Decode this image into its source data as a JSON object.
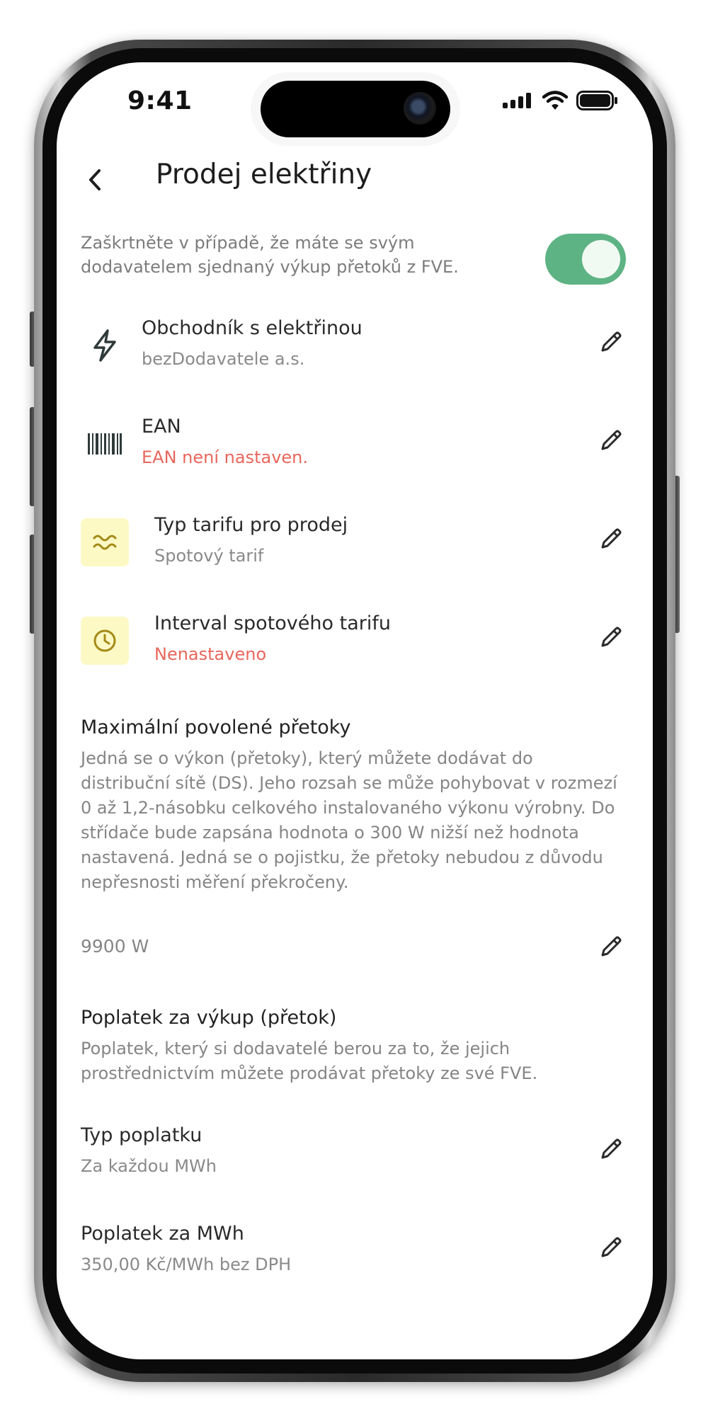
{
  "status_bar": {
    "time": "9:41"
  },
  "header": {
    "title": "Prodej elektřiny"
  },
  "intro": {
    "text": "Zaškrtněte v případě, že máte se svým dodavatelem sjednaný výkup přetoků z FVE.",
    "toggle_on": true,
    "toggle_color": "#5eb384"
  },
  "rows": [
    {
      "icon": "lightning-icon",
      "title": "Obchodník s elektřinou",
      "subtitle": "bezDodavatele a.s.",
      "subtitle_error": false
    },
    {
      "icon": "barcode-icon",
      "title": "EAN",
      "subtitle": "EAN není nastaven.",
      "subtitle_error": true
    },
    {
      "icon": "tariff-wave-icon",
      "title": "Typ tarifu pro prodej",
      "subtitle": "Spotový tarif",
      "subtitle_error": false
    },
    {
      "icon": "clock-icon",
      "title": "Interval spotového tarifu",
      "subtitle": "Nenastaveno",
      "subtitle_error": true
    }
  ],
  "max_flow": {
    "title": "Maximální povolené přetoky",
    "description": "Jedná se o výkon (přetoky), který můžete dodávat do distribuční sítě (DS). Jeho rozsah se může pohybovat v rozmezí 0 až 1,2-násobku celkového instalovaného výkonu výrobny. Do střídače bude zapsána hodnota o 300 W nižší než hodnota nastavená. Jedná se o pojistku, že přetoky nebudou z důvodu nepřesnosti měření překročeny.",
    "value": "9900 W"
  },
  "fee": {
    "title": "Poplatek za výkup (přetok)",
    "description": "Poplatek, který si dodavatelé berou za to, že jejich prostřednictvím můžete prodávat přetoky ze své FVE.",
    "rows": [
      {
        "title": "Typ poplatku",
        "subtitle": "Za každou MWh"
      },
      {
        "title": "Poplatek za MWh",
        "subtitle": "350,00 Kč/MWh bez DPH"
      }
    ]
  },
  "colors": {
    "error": "#e8675d",
    "accent": "#5eb384",
    "tile": "#fdf9c5",
    "tile_icon": "#a48a18"
  }
}
